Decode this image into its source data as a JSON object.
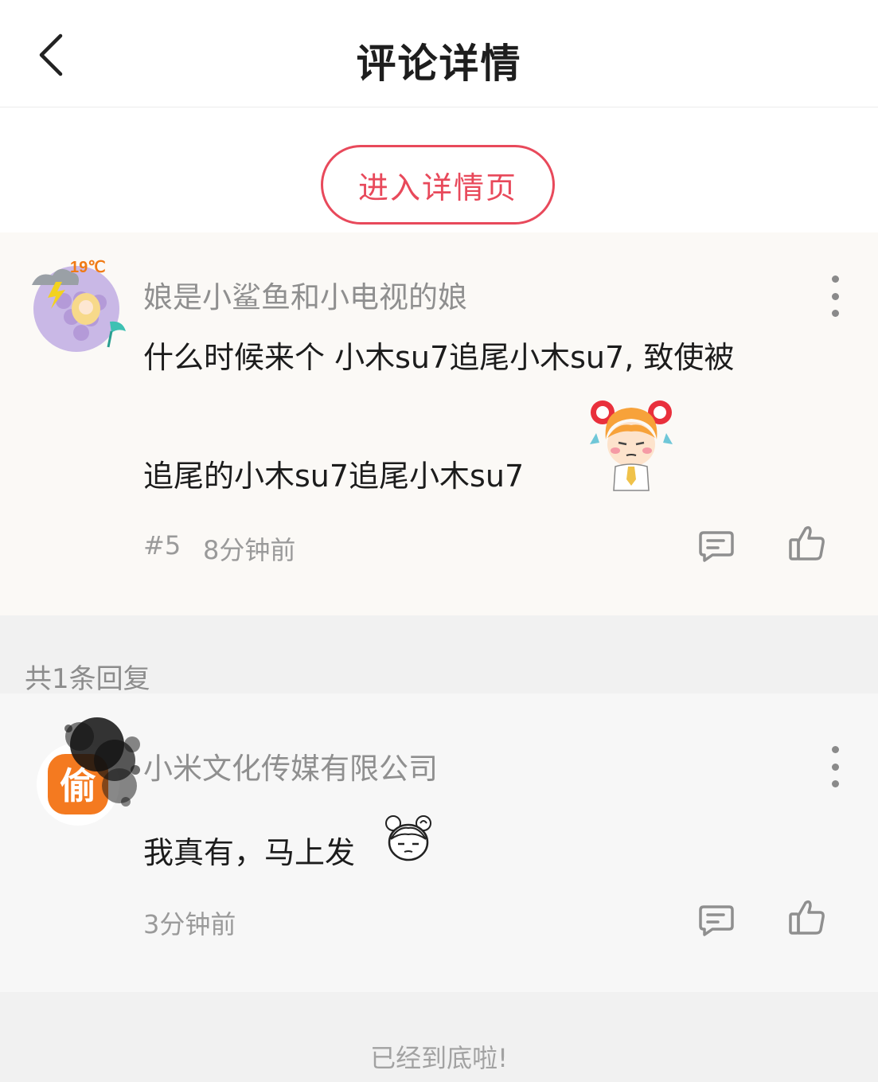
{
  "header": {
    "title": "评论详情",
    "back_icon": "chevron-left-icon"
  },
  "enter_details": {
    "label": "进入详情页",
    "accent_color": "#e8495b"
  },
  "main_comment": {
    "user": {
      "name": "娘是小鲨鱼和小电视的娘",
      "avatar_badge": "19℃"
    },
    "text_line1": "什么时候来个 小木su7追尾小木su7, 致使被",
    "text_line2": "追尾的小木su7追尾小木su7",
    "sticker": "girl-sticker",
    "floor": "#5",
    "time": "8分钟前"
  },
  "replies": {
    "count_label": "共1条回复",
    "items": [
      {
        "user": {
          "name": "小米文化传媒有限公司",
          "avatar_glyph": "偷"
        },
        "text": "我真有，马上发",
        "sticker": "face-sticker",
        "time": "3分钟前"
      }
    ]
  },
  "footer": {
    "end_text": "已经到底啦!"
  }
}
